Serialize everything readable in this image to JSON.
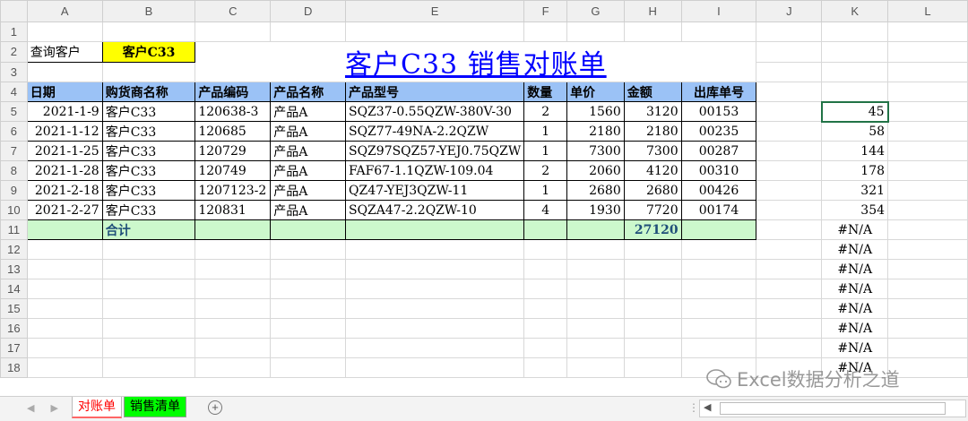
{
  "columns": [
    "A",
    "B",
    "C",
    "D",
    "E",
    "F",
    "G",
    "H",
    "I",
    "J",
    "K",
    "L"
  ],
  "rows": [
    "1",
    "2",
    "3",
    "4",
    "5",
    "6",
    "7",
    "8",
    "9",
    "10",
    "11",
    "12",
    "13",
    "14",
    "15",
    "16",
    "17",
    "18"
  ],
  "query": {
    "label": "查询客户",
    "value": "客户C33"
  },
  "title": "客户C33   销售对账单",
  "table": {
    "headers": [
      "日期",
      "购货商名称",
      "产品编码",
      "产品名称",
      "产品型号",
      "数量",
      "单价",
      "金额",
      "出库单号"
    ],
    "rows": [
      [
        "2021-1-9",
        "客户C33",
        "120638-3",
        "产品A",
        "SQZ37-0.55QZW-380V-30",
        "2",
        "1560",
        "3120",
        "00153"
      ],
      [
        "2021-1-12",
        "客户C33",
        "120685",
        "产品A",
        "SQZ77-49NA-2.2QZW",
        "1",
        "2180",
        "2180",
        "00235"
      ],
      [
        "2021-1-25",
        "客户C33",
        "120729",
        "产品A",
        "SQZ97SQZ57-YEJ0.75QZW",
        "1",
        "7300",
        "7300",
        "00287"
      ],
      [
        "2021-1-28",
        "客户C33",
        "120749",
        "产品A",
        "FAF67-1.1QZW-109.04",
        "2",
        "2060",
        "4120",
        "00310"
      ],
      [
        "2021-2-18",
        "客户C33",
        "1207123-2",
        "产品A",
        "QZ47-YEJ3QZW-11",
        "1",
        "2680",
        "2680",
        "00426"
      ],
      [
        "2021-2-27",
        "客户C33",
        "120831",
        "产品A",
        "SQZA47-2.2QZW-10",
        "4",
        "1930",
        "7720",
        "00174"
      ]
    ],
    "total_label": "合计",
    "total_value": "27120"
  },
  "helper_column_k": [
    "45",
    "58",
    "144",
    "178",
    "321",
    "354",
    "#N/A",
    "#N/A",
    "#N/A",
    "#N/A",
    "#N/A",
    "#N/A",
    "#N/A",
    "#N/A"
  ],
  "sheet_tabs": [
    "对账单",
    "销售清单"
  ],
  "watermark": "Excel数据分析之道"
}
